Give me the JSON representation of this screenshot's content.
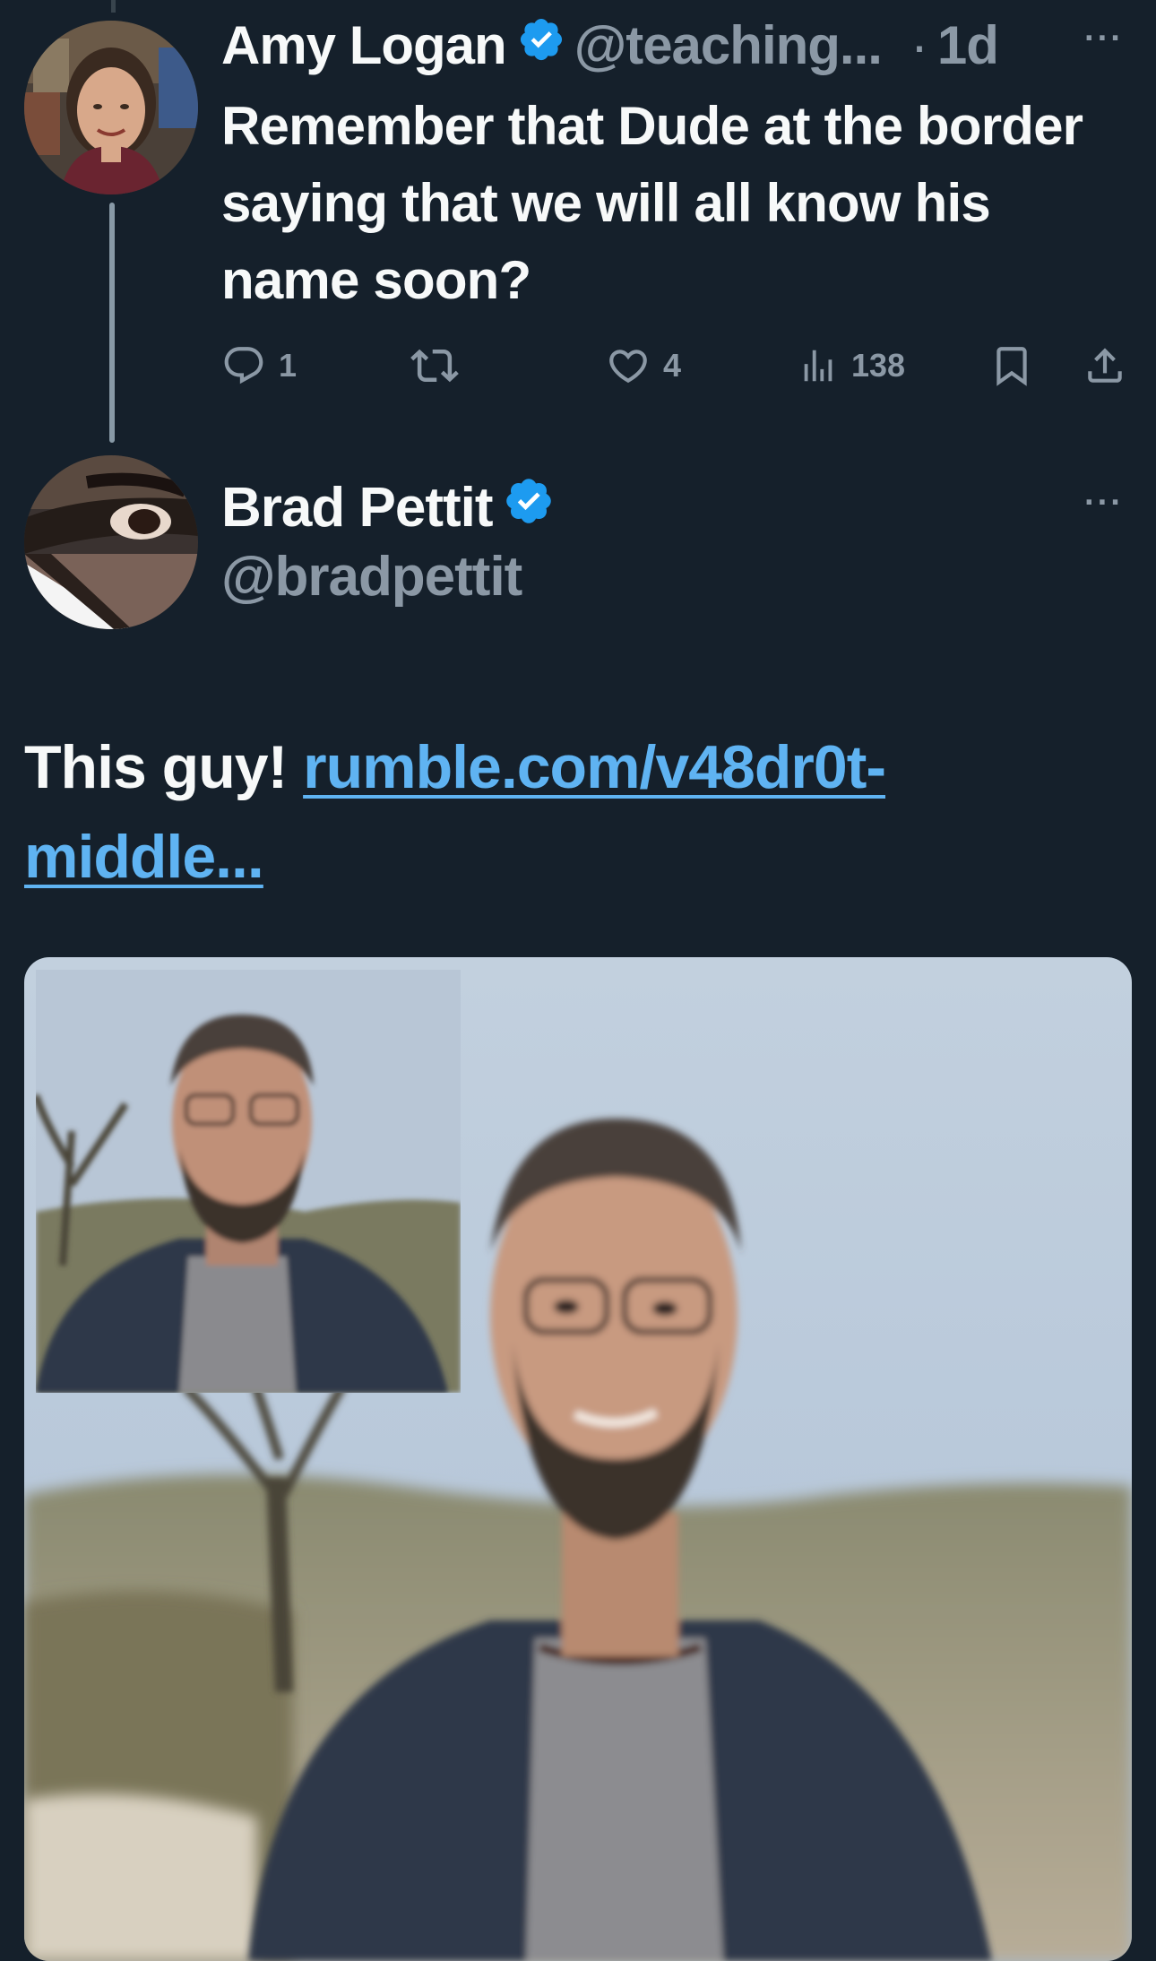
{
  "tweet1": {
    "author_name": "Amy Logan",
    "handle": "@teaching...",
    "separator": "·",
    "time": "1d",
    "more": "···",
    "text": "Remember that Dude at the border saying that we will all know his name soon?",
    "actions": {
      "reply_count": "1",
      "retweet_count": "",
      "like_count": "4",
      "views_count": "138"
    }
  },
  "tweet2": {
    "author_name": "Brad Pettit",
    "handle": "@bradpettit",
    "more": "···",
    "text_prefix": "This guy! ",
    "link_text": "rumble.com/v48dr0t-middle..."
  },
  "colors": {
    "background": "#15202b",
    "verified_badge": "#1d9bf0",
    "link": "#5fb3f2",
    "secondary_text": "#8b98a5"
  },
  "icons": {
    "reply": "reply-icon",
    "retweet": "retweet-icon",
    "like": "heart-icon",
    "views": "views-chart-icon",
    "bookmark": "bookmark-icon",
    "share": "share-icon",
    "verified": "verified-badge-icon"
  }
}
